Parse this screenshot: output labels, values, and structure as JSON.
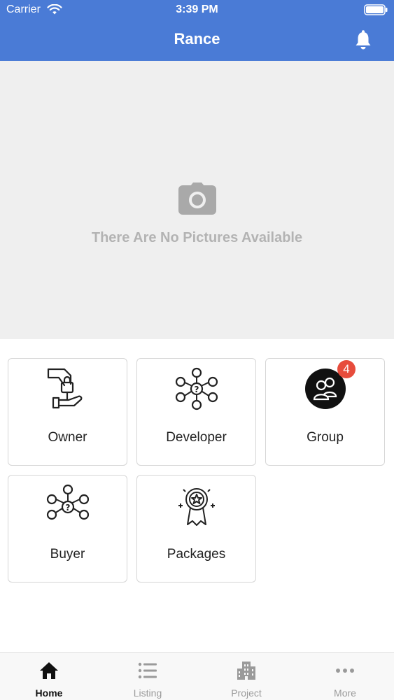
{
  "status_bar": {
    "carrier": "Carrier",
    "time": "3:39 PM"
  },
  "header": {
    "title": "Rance"
  },
  "gallery": {
    "empty_message": "There Are No Pictures Available"
  },
  "tiles": [
    {
      "label": "Owner"
    },
    {
      "label": "Developer"
    },
    {
      "label": "Group",
      "badge": "4"
    },
    {
      "label": "Buyer"
    },
    {
      "label": "Packages"
    }
  ],
  "tabbar": {
    "items": [
      {
        "label": "Home",
        "icon": "home-icon",
        "active": true
      },
      {
        "label": "Listing",
        "icon": "list-icon"
      },
      {
        "label": "Project",
        "icon": "building-icon"
      },
      {
        "label": "More",
        "icon": "more-dots-icon"
      }
    ]
  },
  "colors": {
    "header": "#4a7bd6",
    "badge": "#e74c3c",
    "placeholder_text": "#b3b3b3"
  }
}
